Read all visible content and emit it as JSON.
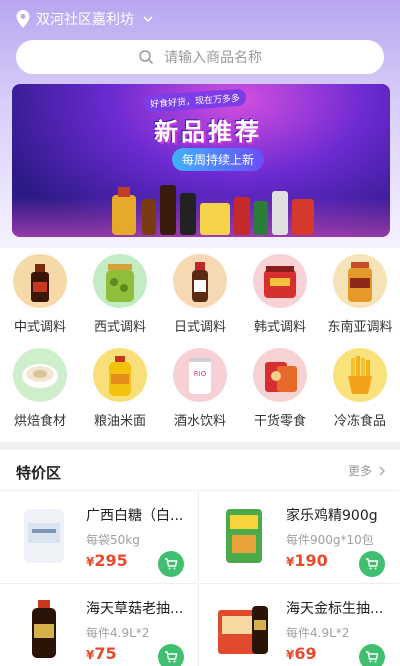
{
  "header": {
    "location": "双河社区嘉利坊"
  },
  "search": {
    "placeholder": "请输入商品名称"
  },
  "banner": {
    "tag": "好食好货，现在万多多",
    "title": "新品推荐",
    "subtitle": "每周持续上新"
  },
  "categories": [
    {
      "label": "中式调料",
      "icon": "soy-sauce-bottle-icon"
    },
    {
      "label": "西式调料",
      "icon": "pickles-jar-icon"
    },
    {
      "label": "日式调料",
      "icon": "sauce-bottle-icon"
    },
    {
      "label": "韩式调料",
      "icon": "chili-paste-box-icon"
    },
    {
      "label": "东南亚调料",
      "icon": "jar-icon"
    },
    {
      "label": "烘焙食材",
      "icon": "flour-bowl-icon"
    },
    {
      "label": "粮油米面",
      "icon": "oil-bottle-icon"
    },
    {
      "label": "酒水饮料",
      "icon": "drink-can-icon"
    },
    {
      "label": "干货零食",
      "icon": "snack-bag-icon"
    },
    {
      "label": "冷冻食品",
      "icon": "fries-icon"
    }
  ],
  "deals": {
    "title": "特价区",
    "more": "更多",
    "items": [
      {
        "name": "广西白糖（白...",
        "spec": "每袋50kg",
        "price_symbol": "¥",
        "price": "295"
      },
      {
        "name": "家乐鸡精900g",
        "spec": "每件900g*10包",
        "price_symbol": "¥",
        "price": "190"
      },
      {
        "name": "海天草菇老抽...",
        "spec": "每件4.9L*2",
        "price_symbol": "¥",
        "price": "75"
      },
      {
        "name": "海天金标生抽...",
        "spec": "每件4.9L*2",
        "price_symbol": "¥",
        "price": "69"
      }
    ]
  },
  "colors": {
    "accent_green": "#3fbf6f",
    "price_red": "#e84b2c",
    "header_purple": "#b9a6f0"
  }
}
